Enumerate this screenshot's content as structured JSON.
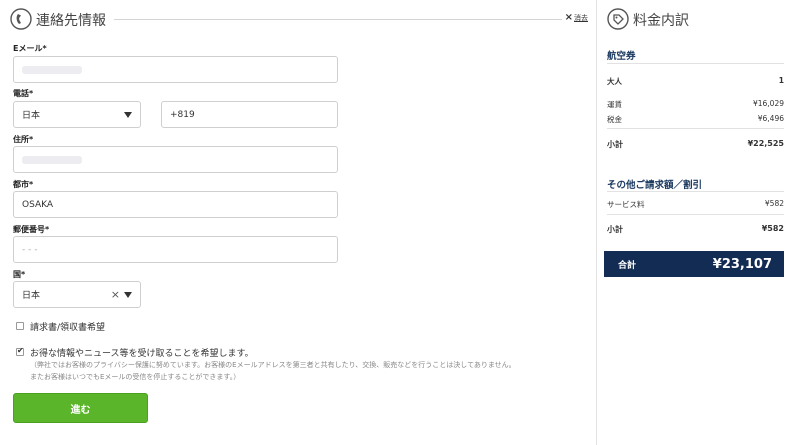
{
  "contact": {
    "title": "連絡先情報",
    "close_label": "消去",
    "email": {
      "label": "Eメール*",
      "value": ""
    },
    "phone": {
      "label": "電話*",
      "country": "日本",
      "number": "+819"
    },
    "address": {
      "label": "住所*",
      "value": ""
    },
    "city": {
      "label": "都市*",
      "value": "OSAKA"
    },
    "zip": {
      "label": "郵便番号*",
      "placeholder": "- - -"
    },
    "country": {
      "label": "国*",
      "value": "日本"
    },
    "invoice_checkbox": {
      "label": "請求書/領収書希望",
      "checked": false
    },
    "news_checkbox": {
      "label": "お得な情報やニュース等を受け取ることを希望します。",
      "checked": true,
      "note_line1": "（弊社ではお客様のプライバシー保護に努めています。お客様のEメールアドレスを第三者と共有したり、交換、販売などを行うことは決してありません。",
      "note_line2": "またお客様はいつでもEメールの受信を停止することができます。）"
    },
    "submit_label": "進む"
  },
  "summary": {
    "title": "料金内訳",
    "airfare": {
      "heading": "航空券",
      "adults_label": "大人",
      "adults_value": "1",
      "fare_label": "運賃",
      "fare_value": "¥16,029",
      "tax_label": "税金",
      "tax_value": "¥6,496",
      "subtotal_label": "小計",
      "subtotal_value": "¥22,525"
    },
    "other": {
      "heading": "その他ご請求額／割引",
      "service_label": "サービス料",
      "service_value": "¥582",
      "subtotal_label": "小計",
      "subtotal_value": "¥582"
    },
    "total_label": "合計",
    "total_value": "¥23,107"
  },
  "colors": {
    "accent_green": "#5ab52a",
    "navy": "#132c53",
    "section_blue": "#1b3a60"
  }
}
